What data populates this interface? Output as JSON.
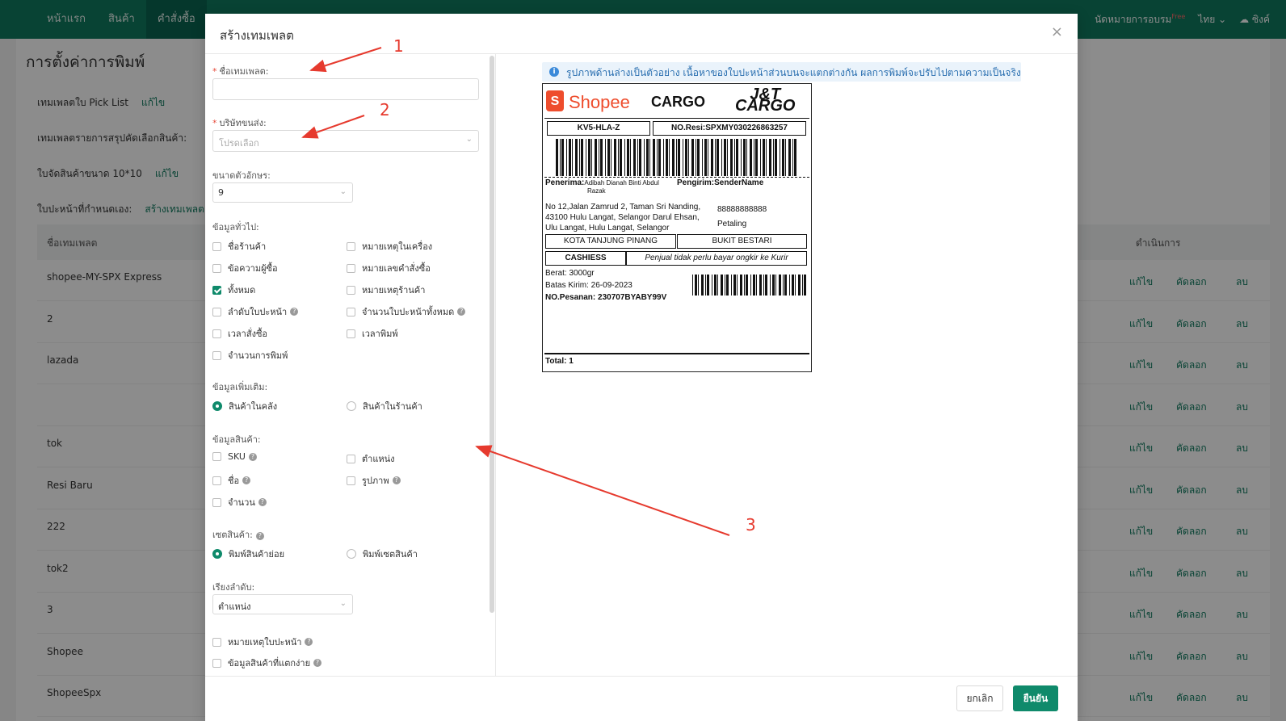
{
  "nav": {
    "items": [
      "หน้าแรก",
      "สินค้า",
      "คำสั่งซื้อ"
    ],
    "right": {
      "training": "นัดหมายการอบรม",
      "free": "Free",
      "lang": "ไทย",
      "sync": "ซิงค์"
    }
  },
  "page": {
    "title": "การตั้งค่าการพิมพ์",
    "settings": [
      {
        "label": "เทมเพลตใบ Pick List",
        "link": "แก้ไข"
      },
      {
        "label": "เทมเพลตรายการสรุปคัดเลือกสินค้า:",
        "link": ""
      },
      {
        "label": "ใบจัดสินค้าขนาด 10*10",
        "link": "แก้ไข"
      },
      {
        "label": "ใบปะหน้าที่กำหนดเอง:",
        "link": "สร้างเทมเพลต"
      }
    ],
    "table": {
      "headers": {
        "name": "ชื่อเทมเพลต",
        "actions": "ดำเนินการ"
      },
      "rows": [
        "shopee-MY-SPX Express",
        "2",
        "lazada",
        "",
        "tok",
        "Resi Baru",
        "222",
        "tok2",
        "3",
        "Shopee",
        "ShopeeSpx"
      ],
      "actions": {
        "edit": "แก้ไข",
        "copy": "คัดลอก",
        "delete": "ลบ"
      }
    }
  },
  "modal": {
    "title": "สร้างเทมเพลต",
    "template_name": {
      "label": "ชื่อเทมเพลต:",
      "value": ""
    },
    "carrier": {
      "label": "บริษัทขนส่ง:",
      "placeholder": "โปรดเลือก"
    },
    "font_size": {
      "label": "ขนาดตัวอักษร:",
      "value": "9"
    },
    "general": {
      "label": "ข้อมูลทั่วไป:",
      "options": [
        {
          "label": "ชื่อร้านค้า",
          "checked": false
        },
        {
          "label": "หมายเหตุในเครื่อง",
          "checked": false
        },
        {
          "label": "ข้อความผู้ซื้อ",
          "checked": false
        },
        {
          "label": "หมายเลขคำสั่งซื้อ",
          "checked": false
        },
        {
          "label": "ทั้งหมด",
          "checked": true
        },
        {
          "label": "หมายเหตุร้านค้า",
          "checked": false
        },
        {
          "label": "ลำดับใบปะหน้า",
          "checked": false
        },
        {
          "label": "จำนวนใบปะหน้าทั้งหมด",
          "checked": false
        },
        {
          "label": "เวลาสั่งซื้อ",
          "checked": false
        },
        {
          "label": "เวลาพิมพ์",
          "checked": false
        },
        {
          "label": "จำนวนการพิมพ์",
          "checked": false
        }
      ]
    },
    "extra": {
      "label": "ข้อมูลเพิ่มเติม:",
      "options": [
        "สินค้าในคลัง",
        "สินค้าในร้านค้า"
      ],
      "selected": 0
    },
    "product": {
      "label": "ข้อมูลสินค้า:",
      "options": [
        "SKU",
        "ตำแหน่ง",
        "ชื่อ",
        "รูปภาพ",
        "จำนวน"
      ]
    },
    "product_set": {
      "label": "เซตสินค้า:",
      "options": [
        "พิมพ์สินค้าย่อย",
        "พิมพ์เซตสินค้า"
      ],
      "selected": 0
    },
    "sort": {
      "label": "เรียงลำดับ:",
      "value": "ตำแหน่ง"
    },
    "bottom_options": [
      "หมายเหตุใบปะหน้า",
      "ข้อมูลสินค้าที่แตกง่าย"
    ],
    "notice": "รูปภาพด้านล่างเป็นตัวอย่าง เนื้อหาของใบปะหน้าส่วนบนจะแตกต่างกัน ผลการพิมพ์จะปรับไปตามความเป็นจริง",
    "cancel": "ยกเลิก",
    "confirm": "ยืนยัน"
  },
  "label_preview": {
    "brand": "Shopee",
    "brand_letter": "S",
    "cargo": "CARGO",
    "jt_line1": "J&T",
    "jt_line2": "CARGO",
    "code": "KV5-HLA-Z",
    "resi": "NO.Resi:SPXMY030226863257",
    "penerima_label": "Penerima:",
    "penerima_name": "Adibah Dianah Binti Abdul",
    "penerima_name2": "Razak",
    "pengirim": "Pengirim:SenderName",
    "address1": "No 12,Jalan Zamrud 2, Taman Sri Nanding,",
    "address2": "43100 Hulu Langat, Selangor Darul Ehsan,",
    "address3": "Ulu Langat, Hulu Langat, Selangor",
    "phone": "88888888888",
    "city": "Petaling",
    "origin": "KOTA TANJUNG PINANG",
    "dest": "BUKIT BESTARI",
    "payment": "CASHIESS",
    "payment_note": "Penjual tidak perlu bayar ongkir ke Kurir",
    "berat": "Berat: 3000gr",
    "batas": "Batas Kirim: 26-09-2023",
    "pesanan": "NO.Pesanan: 230707BYABY99V",
    "total": "Total: 1"
  },
  "annotations": [
    "1",
    "2",
    "3"
  ]
}
